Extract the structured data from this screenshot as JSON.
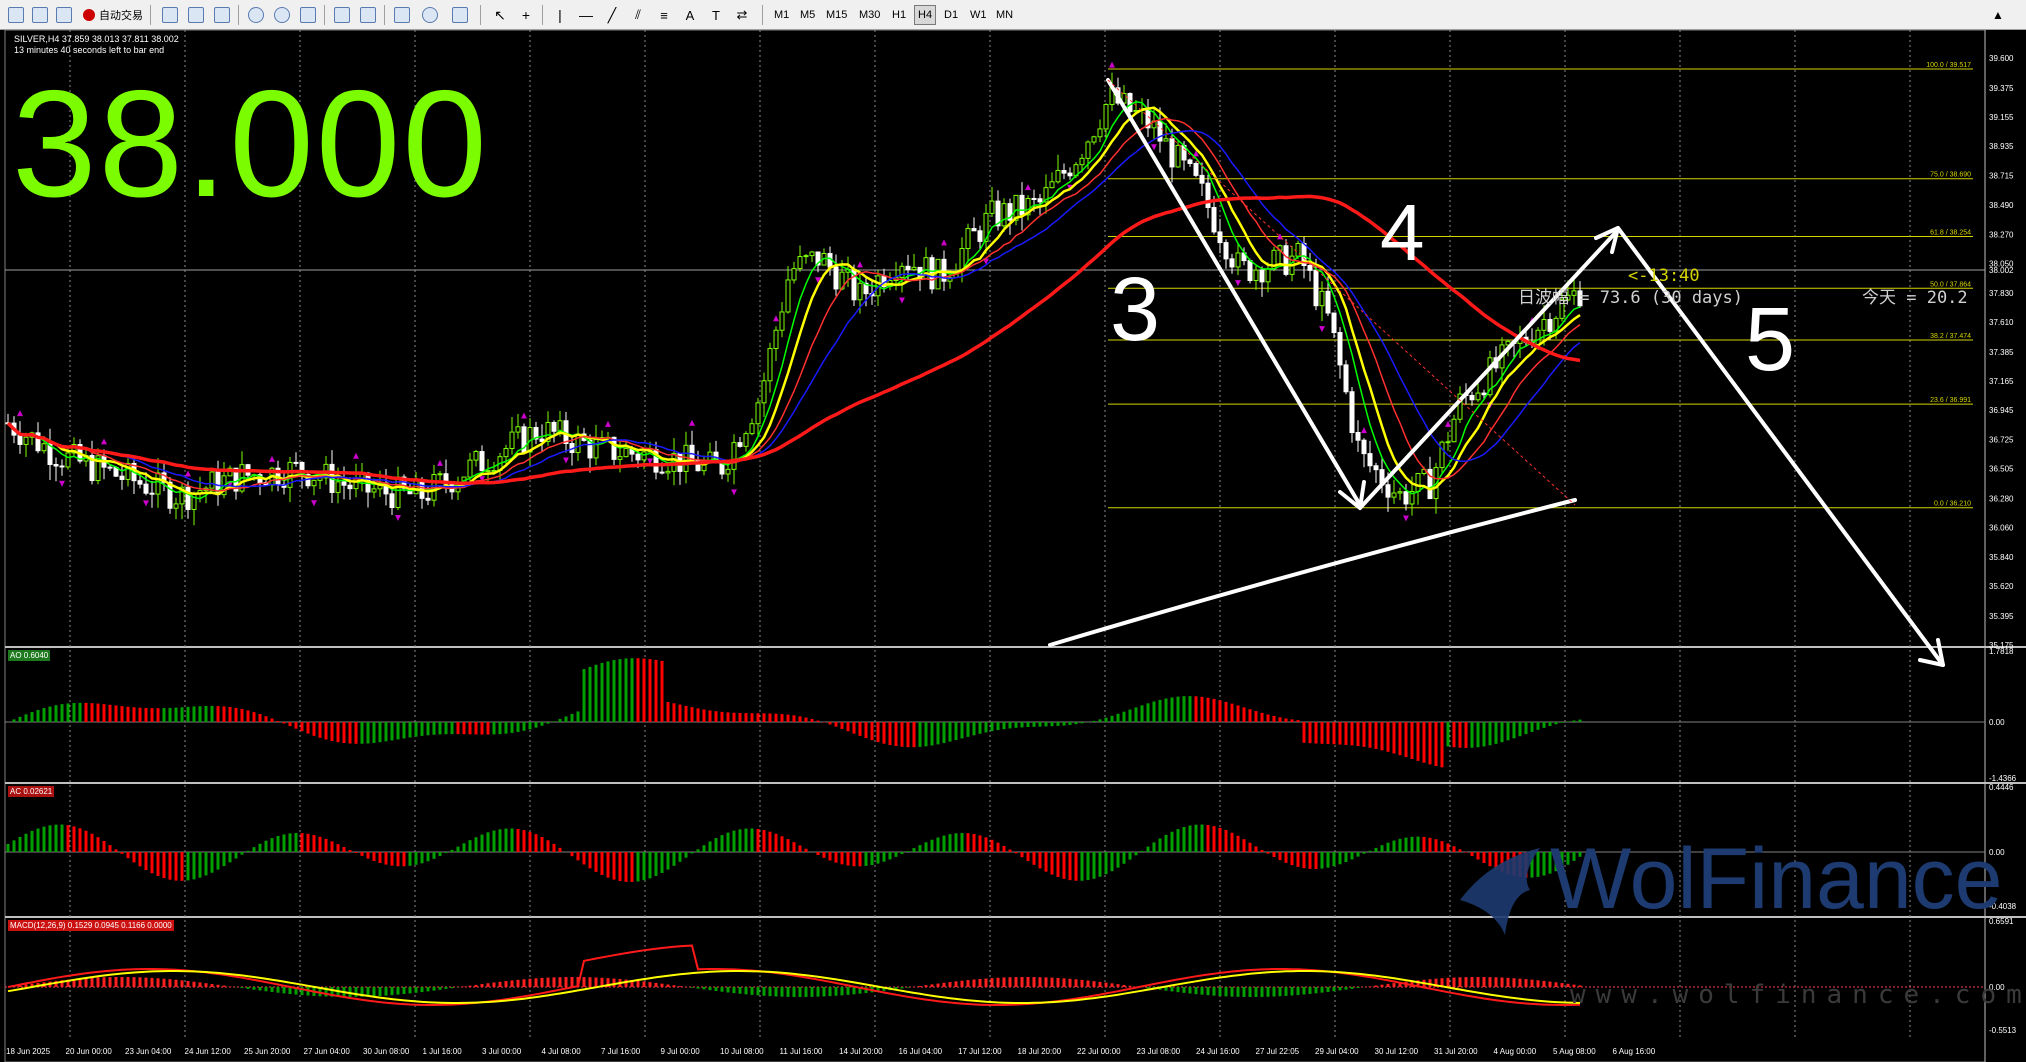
{
  "toolbar": {
    "autotrade_label": "自动交易",
    "timeframes": [
      "M1",
      "M5",
      "M15",
      "M30",
      "H1",
      "H4",
      "D1",
      "W1",
      "MN"
    ],
    "active_timeframe": "H4"
  },
  "chart": {
    "symbol_line": "SILVER,H4  37.859 38.013 37.811 38.002",
    "countdown": "13 minutes 40 seconds left to bar end",
    "big_price": "38.000",
    "timer_label": "<-13:40",
    "amplitude_label": "日波幅 = 73.6 (30 days)",
    "today_label": "今天 = 20.2",
    "current_price_tag": "38.002",
    "wave_labels": [
      "3",
      "4",
      "5"
    ],
    "colors": {
      "background": "#000000",
      "up_candle": "#7cfc00",
      "price_text": "#7cfc00",
      "fib_line": "#d4d400",
      "ma_red": "#ff1a1a",
      "ma_blue": "#1a1aff",
      "ma_yellow": "#ffff00",
      "ma_green": "#00ff00",
      "fractal": "#cc00cc",
      "ao_up": "#00a000",
      "ao_down": "#ff0000"
    },
    "price_axis": [
      "39.600",
      "39.375",
      "39.155",
      "38.935",
      "38.715",
      "38.490",
      "38.270",
      "38.050",
      "37.830",
      "37.610",
      "37.385",
      "37.165",
      "36.945",
      "36.725",
      "36.505",
      "36.280",
      "36.060",
      "35.840",
      "35.620",
      "35.395",
      "35.175"
    ],
    "fib_levels": [
      {
        "label": "100.0 / 39.517",
        "price": 39.517
      },
      {
        "label": "75.0 / 38.690",
        "price": 38.69
      },
      {
        "label": "61.8 / 38.254",
        "price": 38.254
      },
      {
        "label": "50.0 / 37.864",
        "price": 37.864
      },
      {
        "label": "38.2 / 37.474",
        "price": 37.474
      },
      {
        "label": "23.6 / 36.991",
        "price": 36.991
      },
      {
        "label": "0.0 / 36.210",
        "price": 36.21
      }
    ],
    "time_axis": [
      "18 Jun 2025",
      "20 Jun 00:00",
      "23 Jun 04:00",
      "24 Jun 12:00",
      "25 Jun 20:00",
      "27 Jun 04:00",
      "30 Jun 08:00",
      "1 Jul 16:00",
      "3 Jul 00:00",
      "4 Jul 08:00",
      "7 Jul 16:00",
      "9 Jul 00:00",
      "10 Jul 08:00",
      "11 Jul 16:00",
      "14 Jul 20:00",
      "16 Jul 04:00",
      "17 Jul 12:00",
      "18 Jul 20:00",
      "22 Jul 00:00",
      "23 Jul 08:00",
      "24 Jul 16:00",
      "27 Jul 22:05",
      "29 Jul 04:00",
      "30 Jul 12:00",
      "31 Jul 20:00",
      "4 Aug 00:00",
      "5 Aug 08:00",
      "6 Aug 16:00"
    ]
  },
  "ao_panel": {
    "label": "AO 0.6040",
    "axis": [
      "1.7818",
      "0.00",
      "-1.4366"
    ]
  },
  "ac_panel": {
    "label": "AC 0.02621",
    "axis": [
      "0.4446",
      "0.00",
      "-0.4038"
    ]
  },
  "macd_panel": {
    "label": "MACD(12,26,9) 0.1529 0.0945 0.1166 0.0000",
    "axis": [
      "0.6591",
      "0.00",
      "-0.5513"
    ]
  },
  "watermark": {
    "brand": "WolFinance",
    "url": "www.wolfinance.com"
  }
}
